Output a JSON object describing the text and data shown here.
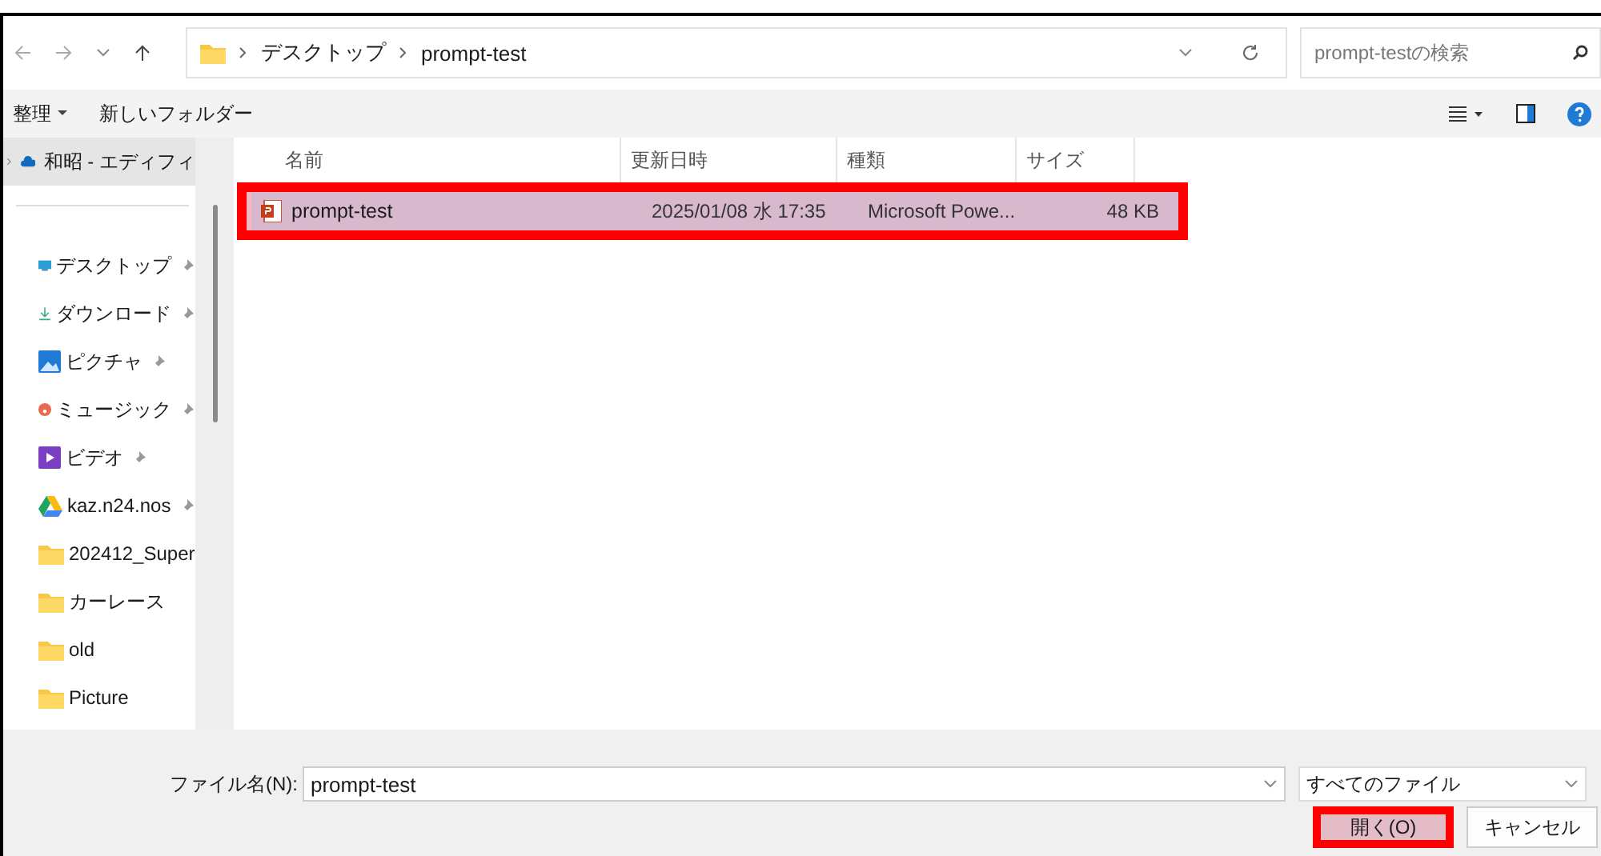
{
  "address_bar": {
    "path": [
      {
        "kind": "folder"
      },
      {
        "kind": "crumb",
        "label": "デスクトップ"
      },
      {
        "kind": "crumb",
        "label": "prompt-test"
      }
    ]
  },
  "search": {
    "placeholder": "prompt-testの検索"
  },
  "toolbar": {
    "organize": "整理",
    "new_folder": "新しいフォルダー"
  },
  "sidebar": {
    "top_item": {
      "label": "和昭 - エディフィ",
      "selected": true
    },
    "items": [
      {
        "kind": "desktop",
        "label": "デスクトップ",
        "pinned": true
      },
      {
        "kind": "download",
        "label": "ダウンロード",
        "pinned": true
      },
      {
        "kind": "pictures",
        "label": "ピクチャ",
        "pinned": true
      },
      {
        "kind": "music",
        "label": "ミュージック",
        "pinned": true
      },
      {
        "kind": "video",
        "label": "ビデオ",
        "pinned": true
      },
      {
        "kind": "drive",
        "label": "kaz.n24.nos",
        "pinned": true
      },
      {
        "kind": "folder",
        "label": "202412_Super",
        "pinned": false
      },
      {
        "kind": "folder",
        "label": "カーレース",
        "pinned": false
      },
      {
        "kind": "folder",
        "label": "old",
        "pinned": false
      },
      {
        "kind": "folder",
        "label": "Picture",
        "pinned": false
      }
    ]
  },
  "table": {
    "columns": [
      "名前",
      "更新日時",
      "種類",
      "サイズ"
    ],
    "rows": [
      {
        "name": "prompt-test",
        "modified": "2025/01/08 水 17:35",
        "type": "Microsoft Powe...",
        "size": "48 KB",
        "selected": true,
        "highlighted": true
      }
    ]
  },
  "footer": {
    "file_name_label": "ファイル名(N):",
    "file_name": "prompt-test",
    "filter": "すべてのファイル",
    "buttons": [
      {
        "label": "開く(O)",
        "highlighted": true
      },
      {
        "label": "キャンセル",
        "highlighted": false
      }
    ]
  }
}
